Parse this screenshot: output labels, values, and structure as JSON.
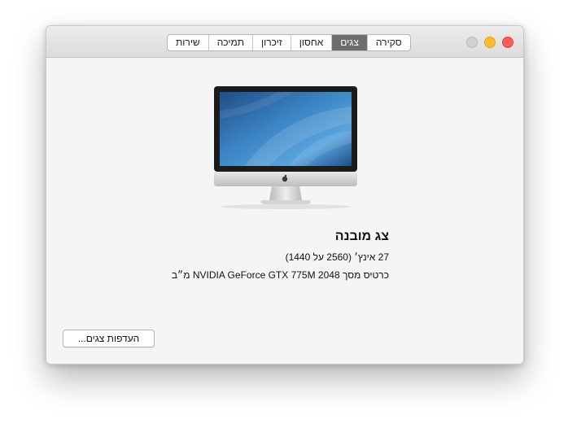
{
  "tabs": [
    {
      "label": "סקירה",
      "active": false
    },
    {
      "label": "צגים",
      "active": true
    },
    {
      "label": "אחסון",
      "active": false
    },
    {
      "label": "זיכרון",
      "active": false
    },
    {
      "label": "תמיכה",
      "active": false
    },
    {
      "label": "שירות",
      "active": false
    }
  ],
  "display": {
    "name": "צג מובנה",
    "size_line": "27 אינץ׳ (2560 על 1440)",
    "graphics_line": "כרטיס מסך NVIDIA GeForce GTX 775M 2048 מ״ב"
  },
  "buttons": {
    "display_prefs": "העדפות צגים..."
  },
  "colors": {
    "active_tab": "#6d6d6d",
    "close": "#fc5f57",
    "minimize": "#fdbc2e",
    "zoom_disabled": "#d0d0d0"
  }
}
